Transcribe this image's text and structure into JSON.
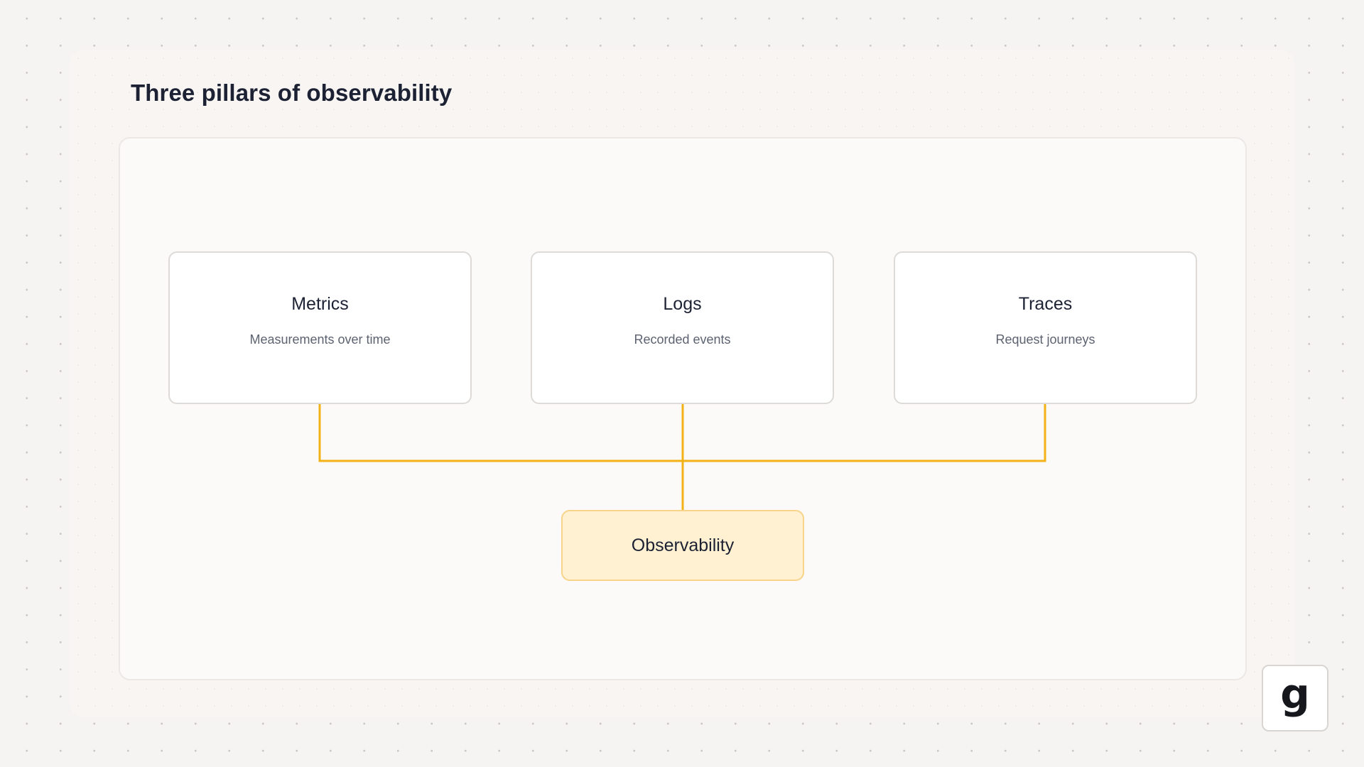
{
  "title": "Three pillars of observability",
  "nodes": [
    {
      "label": "Metrics",
      "description": "Measurements over time"
    },
    {
      "label": "Logs",
      "description": "Recorded events"
    },
    {
      "label": "Traces",
      "description": "Request journeys"
    }
  ],
  "hub": {
    "label": "Observability"
  },
  "edges": [
    {
      "from": "Metrics",
      "to": "Observability"
    },
    {
      "from": "Logs",
      "to": "Observability"
    },
    {
      "from": "Traces",
      "to": "Observability"
    }
  ],
  "logo": {
    "glyph": "g"
  },
  "colors": {
    "connector": "#f2b216",
    "hub_fill": "#fff1d1",
    "hub_border": "#f7d48a",
    "title_text": "#1c2233"
  }
}
